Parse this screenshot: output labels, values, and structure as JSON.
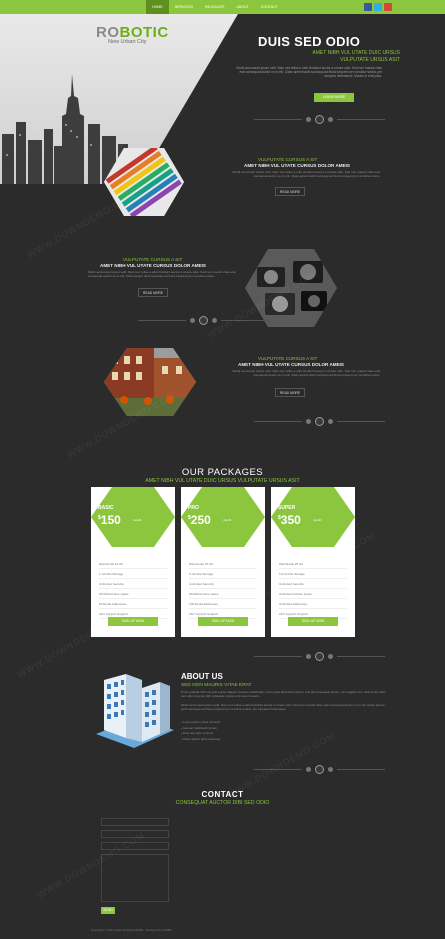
{
  "nav": {
    "items": [
      "Home",
      "Services",
      "Packages",
      "About",
      "Contact"
    ]
  },
  "social": [
    {
      "name": "facebook-icon",
      "color": "#3b5998"
    },
    {
      "name": "twitter-icon",
      "color": "#2fb0e0"
    },
    {
      "name": "google-plus-icon",
      "color": "#d34836"
    }
  ],
  "logo": {
    "part1": "RO",
    "part2": "BOTIC",
    "tagline": "New Urban City"
  },
  "hero": {
    "title": "DUIS SED ODIO",
    "subtitle_line1": "AMET NIBH VUL UTATE DUIC URSUS",
    "subtitle_line2": "VULPUTATE URSUS ASIT",
    "body": "Morbi accumsan ipsum velit. Nam nec tellus a odio tincidunt auctor a ornare odio. Sed non mauris vitae erat consequat auctor eu in elit. Class aptent taciti sociosqu ad litora torquent per conubia nostra, per inceptos himenaeos. Mauris in erat justo.",
    "button": "Learn more"
  },
  "features": [
    {
      "heading": "VULPUTATE CURSUS A SIT",
      "subheading": "AMET NIBH VUL UTATE CURSUS DOLOR AMEIS",
      "text": "Morbi accumsan ipsum velit. Nam nec tellus a odio tincidunt auctor a ornare odio. Sed non mauris vitae erat consequat auctor eu in elit. Class aptent taciti sociosqu ad litora torquent per conubia nostra.",
      "button": "Read more"
    },
    {
      "heading": "VULPUTATE CURSUS A SIT",
      "subheading": "AMET NIBH VUL UTATE CURSUS DOLOR AMEIS",
      "text": "Morbi accumsan ipsum velit. Nam nec tellus a odio tincidunt auctor a ornare odio. Sed non mauris vitae erat consequat auctor eu in elit. Class aptent taciti sociosqu ad litora torquent per conubia nostra.",
      "button": "Read more"
    },
    {
      "heading": "VULPUTATE CURSUS A SIT",
      "subheading": "AMET NIBH VUL UTATE CURSUS DOLOR AMEIS",
      "text": "Morbi accumsan ipsum velit. Nam nec tellus a odio tincidunt auctor a ornare odio. Sed non mauris vitae erat consequat auctor eu in elit. Class aptent taciti sociosqu ad litora torquent per conubia nostra.",
      "button": "Read more"
    }
  ],
  "packages": {
    "title": "OUR PACKAGES",
    "subtitle": "AMET NIBH VUL UTATE DUIC URSUS VULPUTATE URSUS ASIT",
    "plans": [
      {
        "name": "BASIC",
        "currency": "$",
        "price": "150",
        "period": "month",
        "features": [
          "Web Email 10 Gb",
          "1 Gb File Storage",
          "Unlimited Security",
          "25 000 Archive space",
          "50 Email Addresses",
          "24/7 support Support"
        ],
        "button": "Sign up now"
      },
      {
        "name": "PRO",
        "currency": "$",
        "price": "250",
        "period": "month",
        "features": [
          "Web Email 15 Gb",
          "5 Gb File Storage",
          "Unlimited Security",
          "50 000 Archive space",
          "100 Email Addresses",
          "24/7 support Support"
        ],
        "button": "Sign up now"
      },
      {
        "name": "SUPER",
        "currency": "$",
        "price": "350",
        "period": "month",
        "features": [
          "Web Email 25 Gb",
          "10 Gb File Storage",
          "Unlimited Security",
          "Unlimited Archive space",
          "Unlimited Addresses",
          "24/7 support Support"
        ],
        "button": "Sign up now"
      }
    ]
  },
  "about": {
    "title": "ABOUT US",
    "subtitle": "SED NON MAURIS VITAE ERAT",
    "para1": "Proin gravida nibh vel velit auctor aliquet. Aenean sollicitudin, lorem quis bibendum auctor, nisi elit consequat ipsum, nec sagittis sem nibh id elit. Duis sed odio sit amet nibh vulputate cursus a sit amet mauris.",
    "para2": "Morbi accumsan ipsum velit. Nam nec tellus a odio tincidunt auctor a ornare odio. Sed non mauris vitae erat consequat auctor eu in elit. Class aptent taciti sociosqu ad litora torquent per conubia nostra, per inceptos himenaeos.",
    "list": [
      "Lorem ipsum dolor sit amet",
      "Aenean sollicitudin lorem",
      "Duis sed odio sit amet",
      "Class aptent taciti sociosqu"
    ]
  },
  "contact": {
    "title": "CONTACT",
    "subtitle": "CONSEQUAT AUCTOR DIBI SED ODIO",
    "fields": [
      "Name",
      "E-mail",
      "Subject",
      "Message"
    ],
    "button": "Send"
  },
  "footer": {
    "text": "Copyright © 2014 New Template ROBA · Designed by ROBA"
  },
  "watermark": "WWW.DOWNDEMO.COM",
  "colors": {
    "accent": "#8cc63f",
    "background": "#2b2b2b"
  }
}
